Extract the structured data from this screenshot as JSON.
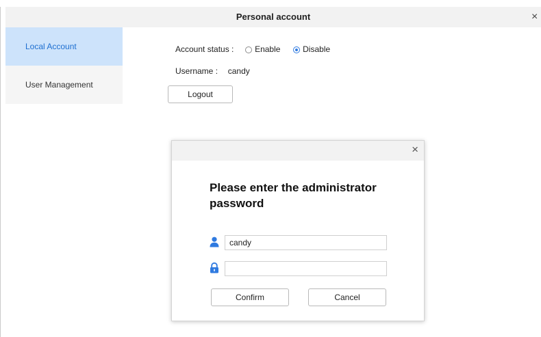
{
  "window": {
    "title": "Personal account",
    "close_glyph": "×"
  },
  "sidebar": {
    "items": [
      {
        "label": "Local Account",
        "active": true
      },
      {
        "label": "User Management",
        "active": false
      }
    ]
  },
  "account": {
    "status_label": "Account status :",
    "options": [
      {
        "label": "Enable",
        "selected": false
      },
      {
        "label": "Disable",
        "selected": true
      }
    ],
    "username_label": "Username :",
    "username_value": "candy",
    "logout_label": "Logout"
  },
  "dialog": {
    "close_glyph": "×",
    "title": "Please enter the administrator password",
    "username_value": "candy",
    "password_value": "",
    "confirm_label": "Confirm",
    "cancel_label": "Cancel"
  },
  "colors": {
    "accent": "#2f7ae0",
    "sidebar_active_bg": "#cde3fb",
    "sidebar_active_text": "#1e6fd0"
  }
}
